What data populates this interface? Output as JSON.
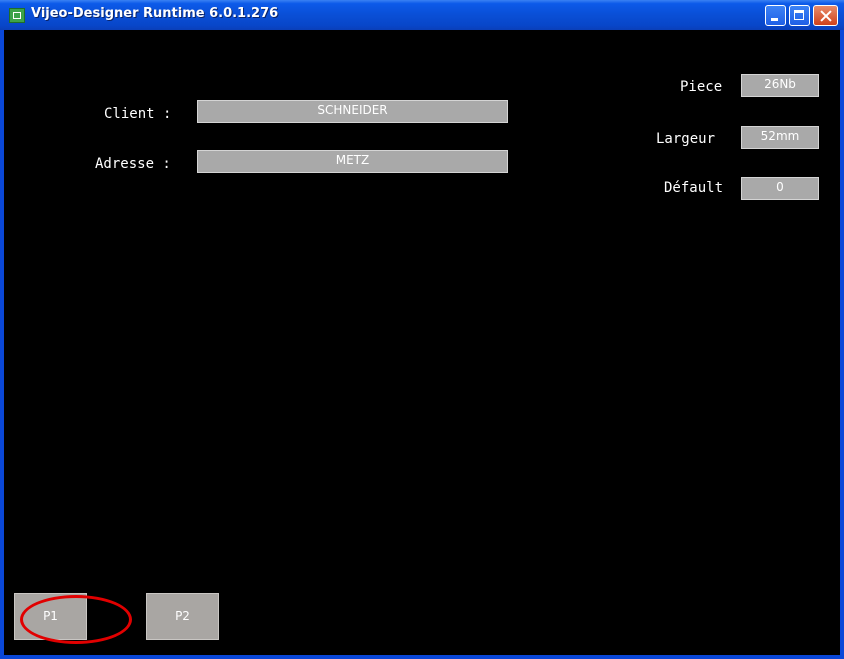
{
  "window": {
    "title": "Vijeo-Designer Runtime 6.0.1.276",
    "icons": [
      "app-icon",
      "minimize-icon",
      "maximize-icon",
      "close-icon"
    ]
  },
  "form": {
    "client_label": "Client :",
    "client_value": "SCHNEIDER",
    "address_label": "Adresse :",
    "address_value": "METZ"
  },
  "stats": {
    "piece_label": "Piece",
    "piece_value": "26Nb",
    "width_label": "Largeur",
    "width_value": "52mm",
    "default_label": "Défault",
    "default_value": "0"
  },
  "nav": {
    "p1_label": "P1",
    "p2_label": "P2"
  },
  "colors": {
    "screen_bg": "#000000",
    "field_bg": "#a9a9a9",
    "button_bg": "#a9a6a3",
    "annotation": "#e10000"
  }
}
